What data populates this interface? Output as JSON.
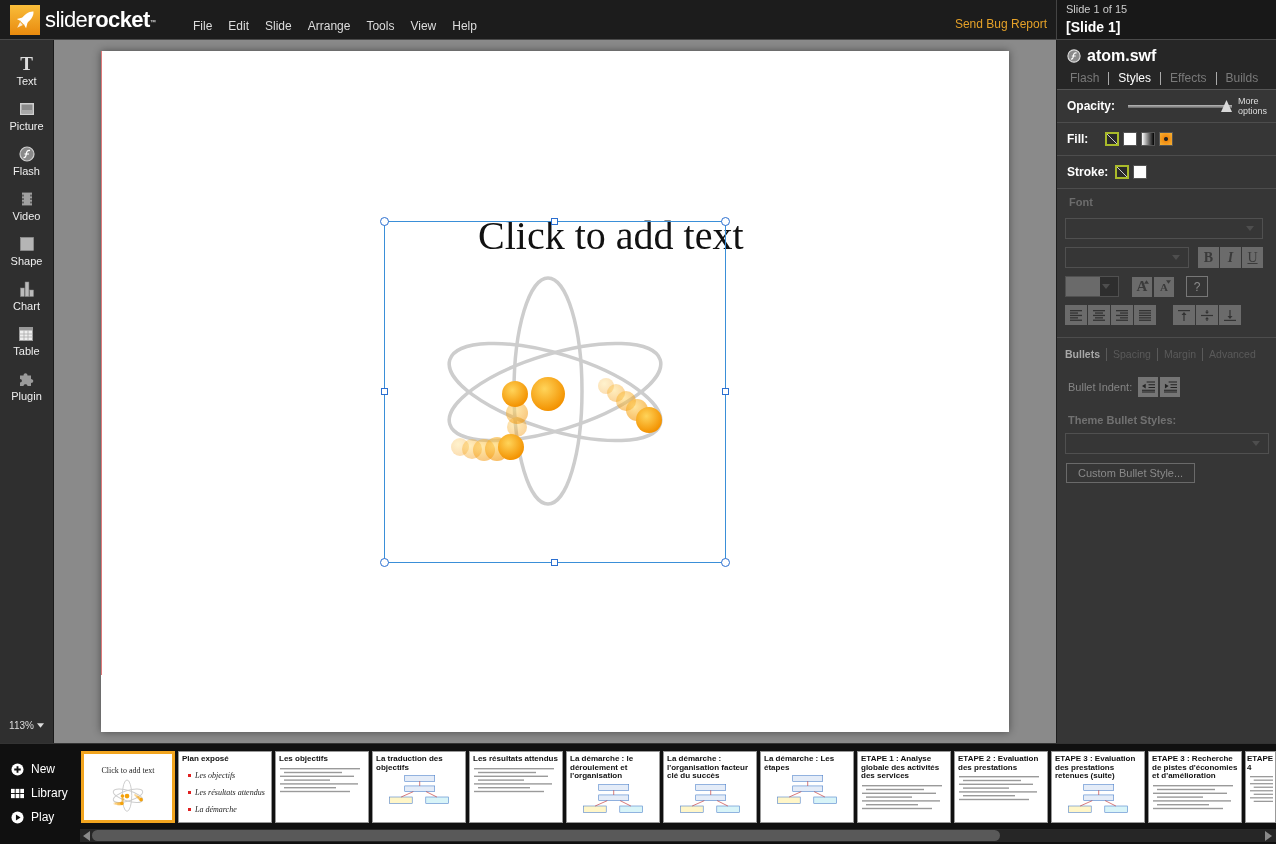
{
  "topbar": {
    "logo": "slide**rocket**$^{™}$",
    "menu": [
      "File",
      "Edit",
      "Slide",
      "Arrange",
      "Tools",
      "View",
      "Help"
    ],
    "bug_report": "Send Bug Report"
  },
  "slide_info": {
    "position": "Slide 1 of 15",
    "name": "[Slide 1]"
  },
  "toolbar": {
    "tools": [
      {
        "label": "Text",
        "kind": "text",
        "glyph": "T"
      },
      {
        "label": "Picture",
        "kind": "picture"
      },
      {
        "label": "Flash",
        "kind": "flash"
      },
      {
        "label": "Video",
        "kind": "video"
      },
      {
        "label": "Shape",
        "kind": "shape"
      },
      {
        "label": "Chart",
        "kind": "chart"
      },
      {
        "label": "Table",
        "kind": "table"
      },
      {
        "label": "Plugin",
        "kind": "plugin"
      }
    ],
    "zoom": "113%"
  },
  "slide": {
    "prompt": "Click to add text"
  },
  "inspector": {
    "title": "atom.swf",
    "tabs": [
      {
        "label": "Flash",
        "selected": false
      },
      {
        "label": "Styles",
        "selected": true
      },
      {
        "label": "Effects",
        "selected": false
      },
      {
        "label": "Builds",
        "selected": false
      }
    ],
    "opacity": {
      "label": "Opacity:",
      "level": 1,
      "more": "More options"
    },
    "fill": {
      "label": "Fill:",
      "swatches": [
        {
          "kind": "none",
          "selected": true
        },
        {
          "kind": "solid",
          "selected": false
        },
        {
          "kind": "gradient",
          "selected": false
        },
        {
          "kind": "image",
          "selected": false
        }
      ]
    },
    "stroke": {
      "label": "Stroke:",
      "swatches": [
        {
          "kind": "none",
          "selected": true
        },
        {
          "kind": "solid",
          "selected": false
        }
      ]
    },
    "font": {
      "heading": "Font",
      "disabled": true,
      "style_buttons": [
        {
          "kind": "bold",
          "label": "B"
        },
        {
          "kind": "italic",
          "label": "I"
        },
        {
          "kind": "underline",
          "label": "U"
        }
      ],
      "size_buttons": [
        {
          "kind": "grow",
          "label": "A"
        },
        {
          "kind": "shrink",
          "label": "A"
        }
      ],
      "help": "?",
      "align_buttons": [
        {
          "kind": "left"
        },
        {
          "kind": "center"
        },
        {
          "kind": "right"
        },
        {
          "kind": "justify"
        }
      ],
      "valign_buttons": [
        {
          "kind": "top"
        },
        {
          "kind": "middle"
        },
        {
          "kind": "bottom"
        }
      ]
    },
    "paragraph": {
      "disabled": true,
      "tabs": [
        {
          "label": "Bullets",
          "selected": true
        },
        {
          "label": "Spacing",
          "selected": false
        },
        {
          "label": "Margin",
          "selected": false
        },
        {
          "label": "Advanced",
          "selected": false
        }
      ],
      "indent_label": "Bullet Indent:",
      "indent_buttons": [
        {
          "kind": "outdent"
        },
        {
          "kind": "indent"
        }
      ],
      "theme_label": "Theme Bullet Styles:",
      "custom_button": "Custom Bullet Style..."
    }
  },
  "strip": {
    "actions": [
      {
        "label": "New",
        "kind": "new"
      },
      {
        "label": "Library",
        "kind": "library"
      },
      {
        "label": "Play",
        "kind": "play"
      }
    ],
    "thumbnails": [
      {
        "kind": "atom",
        "title": "Click to add text",
        "selected": true
      },
      {
        "kind": "list",
        "title": "Plan exposé",
        "items": [
          "Les objectifs",
          "Les résultats attendus",
          "La démarche"
        ],
        "selected": false
      },
      {
        "kind": "lines",
        "title": "Les objectifs",
        "selected": false
      },
      {
        "kind": "diagram",
        "title": "La traduction des objectifs",
        "selected": false
      },
      {
        "kind": "lines",
        "title": "Les résultats attendus",
        "selected": false
      },
      {
        "kind": "diagram",
        "title": "La démarche : le déroulement et l'organisation",
        "selected": false
      },
      {
        "kind": "diagram",
        "title": "La démarche : l'organisation facteur clé du succès",
        "selected": false
      },
      {
        "kind": "diagram",
        "title": "La démarche : Les étapes",
        "selected": false
      },
      {
        "kind": "lines",
        "title": "ETAPE 1 : Analyse globale des activités des services",
        "selected": false
      },
      {
        "kind": "lines",
        "title": "ETAPE 2 : Evaluation des prestations",
        "selected": false
      },
      {
        "kind": "diagram",
        "title": "ETAPE 3 : Evaluation des prestations retenues (suite)",
        "selected": false
      },
      {
        "kind": "lines",
        "title": "ETAPE 3 : Recherche de pistes d'économies et d'amélioration",
        "selected": false
      },
      {
        "kind": "lines",
        "title": "ETAPE 4",
        "selected": false
      }
    ]
  }
}
